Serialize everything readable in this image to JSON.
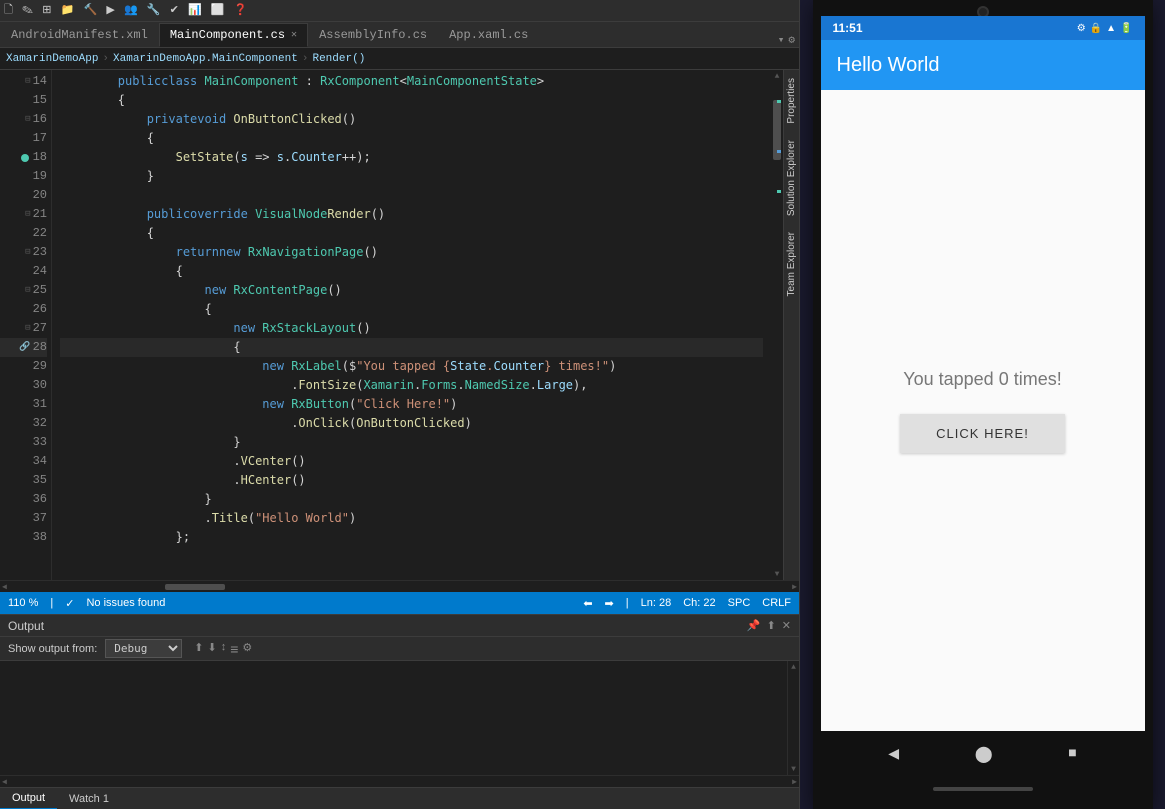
{
  "toolbar": {
    "icons": [
      "file",
      "edit",
      "view",
      "project",
      "build",
      "debug",
      "team",
      "tools",
      "test",
      "analyze",
      "window",
      "help"
    ]
  },
  "tabs": [
    {
      "label": "AndroidManifest.xml",
      "active": false,
      "modified": false
    },
    {
      "label": "MainComponent.cs",
      "active": true,
      "modified": true
    },
    {
      "label": "AssemblyInfo.cs",
      "active": false,
      "modified": false
    },
    {
      "label": "App.xaml.cs",
      "active": false,
      "modified": false
    }
  ],
  "breadcrumb": {
    "project": "XamarinDemoApp",
    "class": "XamarinDemoApp.MainComponent",
    "method": "Render()"
  },
  "code": {
    "lines": [
      {
        "num": 14,
        "text": "        public class MainComponent : RxComponent<MainComponentState>",
        "fold": true
      },
      {
        "num": 15,
        "text": "        {"
      },
      {
        "num": 16,
        "text": "            private void OnButtonClicked()",
        "fold": true
      },
      {
        "num": 17,
        "text": "            {"
      },
      {
        "num": 18,
        "text": "                SetState(s => s.Counter++);"
      },
      {
        "num": 19,
        "text": "            }"
      },
      {
        "num": 20,
        "text": ""
      },
      {
        "num": 21,
        "text": "            public override VisualNode Render()",
        "fold": true
      },
      {
        "num": 22,
        "text": "            {"
      },
      {
        "num": 23,
        "text": "                return new RxNavigationPage()",
        "fold": true
      },
      {
        "num": 24,
        "text": "                {"
      },
      {
        "num": 25,
        "text": "                    new RxContentPage()",
        "fold": true
      },
      {
        "num": 26,
        "text": "                    {"
      },
      {
        "num": 27,
        "text": "                        new RxStackLayout()",
        "fold": true
      },
      {
        "num": 28,
        "text": "                        {",
        "current": true
      },
      {
        "num": 29,
        "text": "                            new RxLabel($\"You tapped {State.Counter} times!\")"
      },
      {
        "num": 30,
        "text": "                                .FontSize(Xamarin.Forms.NamedSize.Large),"
      },
      {
        "num": 31,
        "text": "                            new RxButton(\"Click Here!\")"
      },
      {
        "num": 32,
        "text": "                                .OnClick(OnButtonClicked)"
      },
      {
        "num": 33,
        "text": "                        }"
      },
      {
        "num": 34,
        "text": "                        .VCenter()"
      },
      {
        "num": 35,
        "text": "                        .HCenter()"
      },
      {
        "num": 36,
        "text": "                    }"
      },
      {
        "num": 37,
        "text": "                    .Title(\"Hello World\")"
      },
      {
        "num": 38,
        "text": "                };"
      }
    ]
  },
  "statusBar": {
    "zoom": "110 %",
    "noIssues": "No issues found",
    "lineInfo": "Ln: 28",
    "colInfo": "Ch: 22",
    "encoding": "SPC",
    "lineEnding": "CRLF"
  },
  "output": {
    "title": "Output",
    "showFrom": "Show output from:",
    "source": "Debug",
    "content": ""
  },
  "outputTabs": [
    {
      "label": "Output",
      "active": true
    },
    {
      "label": "Watch 1",
      "active": false
    }
  ],
  "rightSidebar": {
    "tabs": [
      "Properties",
      "Solution Explorer",
      "Team Explorer"
    ]
  },
  "phone": {
    "time": "11:51",
    "appTitle": "Hello World",
    "tapText": "You tapped 0 times!",
    "buttonLabel": "CLICK HERE!",
    "navBack": "◀",
    "navHome": "⬤",
    "navRecent": "■"
  }
}
